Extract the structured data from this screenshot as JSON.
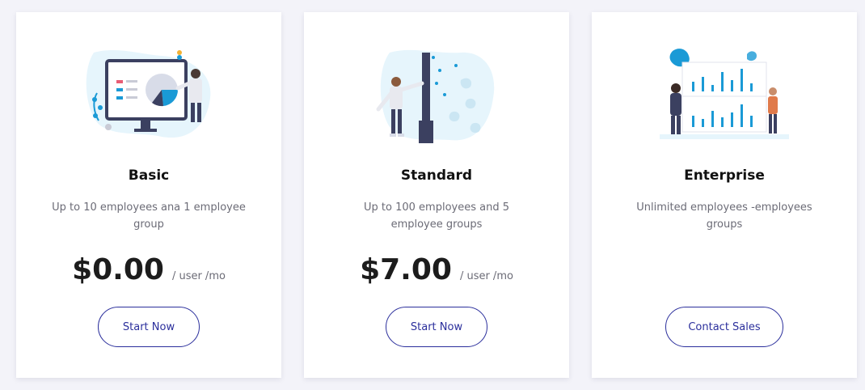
{
  "plans": [
    {
      "title": "Basic",
      "description": "Up to 10 employees ana 1 employee group",
      "price": "$0.00",
      "unit": "/ user /mo",
      "button": "Start Now",
      "illustration": "person-presenting-chart-on-monitor"
    },
    {
      "title": "Standard",
      "description": "Up to 100 employees and 5 employee groups",
      "price": "$7.00",
      "unit": "/ user /mo",
      "button": "Start Now",
      "illustration": "person-leaning-on-pole"
    },
    {
      "title": "Enterprise",
      "description": "Unlimited employees -employees groups",
      "button": "Contact Sales",
      "illustration": "two-people-with-bar-chart-board"
    }
  ],
  "colors": {
    "background": "#f3f3f9",
    "card": "#ffffff",
    "accent": "#2b2f9c",
    "illustration_blue": "#1a9ad6",
    "illustration_light": "#e6f5fc",
    "dark_navy": "#3b4060"
  }
}
